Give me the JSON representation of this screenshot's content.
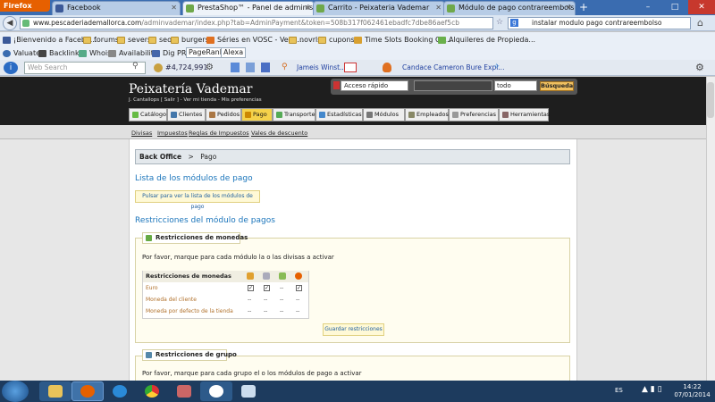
{
  "browser": {
    "menu_button": "Firefox",
    "tabs": [
      {
        "label": "Facebook",
        "icon": "facebook-icon"
      },
      {
        "label": "PrestaShop™ - Panel de administración",
        "icon": "prestashop-icon"
      },
      {
        "label": "Carrito - Peixateria Vademar",
        "icon": "prestashop-icon"
      },
      {
        "label": "Módulo de pago contrareembolso co...",
        "icon": "prestashop-icon"
      }
    ],
    "new_tab": "+",
    "url": {
      "host": "www.pescaderiademallorca.com",
      "path": "/adminvademar/index.php?tab=AdminPayment&token=508b317f062461ebadfc7dbe86aef5cb"
    },
    "search": "instalar modulo pago contrareembolso",
    "window_controls": {
      "minimize": "–",
      "maximize": "□",
      "close": "✕"
    }
  },
  "bookmarks_row1": [
    "¡Bienvenido a Facebo...",
    "forums",
    "severs",
    "seo",
    "burgers",
    "Séries en VOSC - Versi...",
    "novrls",
    "cupons",
    "Time Slots Booking Ca...",
    "Alquileres de Propieda..."
  ],
  "bookmarks_row2": [
    "Valuate",
    "Backlinks",
    "Whois",
    "Availability",
    "Dig PR",
    "PageRank",
    "Alexa"
  ],
  "toolbar": {
    "search_placeholder": "Web Search",
    "rank": "#4,724,991",
    "link1": "Jameis Winst...",
    "link2": "Candace Cameron Bure Expl..."
  },
  "admin": {
    "shop_name": "Peixatería Vademar",
    "user_line": "J. Cantallops [ Salir ] - Ver mi tienda - Mis preferencias",
    "quick_access": "Acceso rápido",
    "search_scope": "todo",
    "search_button": "Búsqueda",
    "menu": [
      {
        "label": "Catálogo",
        "active": false
      },
      {
        "label": "Clientes",
        "active": false
      },
      {
        "label": "Pedidos",
        "active": false
      },
      {
        "label": "Pago",
        "active": true
      },
      {
        "label": "Transporte",
        "active": false
      },
      {
        "label": "Estadísticas",
        "active": false
      },
      {
        "label": "Módulos",
        "active": false
      },
      {
        "label": "Empleados",
        "active": false
      },
      {
        "label": "Preferencias",
        "active": false
      },
      {
        "label": "Herramientas",
        "active": false
      }
    ],
    "submenu": [
      "Divisas",
      "Impuestos",
      "Reglas de Impuestos",
      "Vales de descuento"
    ],
    "breadcrumb": {
      "root": "Back Office",
      "sep": ">",
      "current": "Pago"
    },
    "section1_title": "Lista de los módulos de pago",
    "list_button": "Pulsar para ver la lista de los módulos de pago",
    "section2_title": "Restricciones del módulo de pagos",
    "currency_legend": "Restricciones de monedas",
    "currency_note": "Por favor, marque para cada módulo la o las divisas a activar",
    "currency_table": {
      "header": "Restricciones de monedas",
      "rows": [
        {
          "label": "Euro",
          "cells": [
            "✓",
            "✓",
            "--",
            "✓"
          ]
        },
        {
          "label": "Moneda del cliente",
          "cells": [
            "--",
            "--",
            "--",
            "--"
          ]
        },
        {
          "label": "Moneda por defecto de la tienda",
          "cells": [
            "--",
            "--",
            "--",
            "--"
          ]
        }
      ]
    },
    "save_button": "Guardar restricciones",
    "group_legend": "Restricciones de grupo",
    "group_note": "Por favor, marque para cada grupo el o los módulos de pago a activar"
  },
  "taskbar": {
    "language": "ES",
    "time": "14:22",
    "date": "07/01/2014"
  }
}
